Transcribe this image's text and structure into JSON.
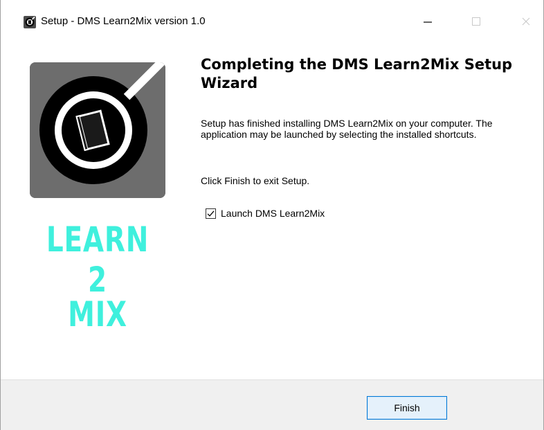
{
  "window": {
    "title": "Setup - DMS Learn2Mix version 1.0",
    "controls": [
      "minimize",
      "maximize",
      "close"
    ]
  },
  "branding": {
    "icon": "book-magnifier-logo-icon",
    "line1": "LEARN",
    "line2": "2",
    "line3": "MIX",
    "accent_color": "#3ff0dd",
    "tile_color": "#6d6d6d"
  },
  "content": {
    "heading": "Completing the DMS Learn2Mix Setup Wizard",
    "body": "Setup has finished installing DMS Learn2Mix on your computer. The application may be launched by selecting the installed shortcuts.",
    "instruction": "Click Finish to exit Setup.",
    "launch_checkbox": {
      "label": "Launch DMS Learn2Mix",
      "checked": true
    }
  },
  "footer": {
    "finish_label": "Finish",
    "button_accent": "#0078d7"
  }
}
